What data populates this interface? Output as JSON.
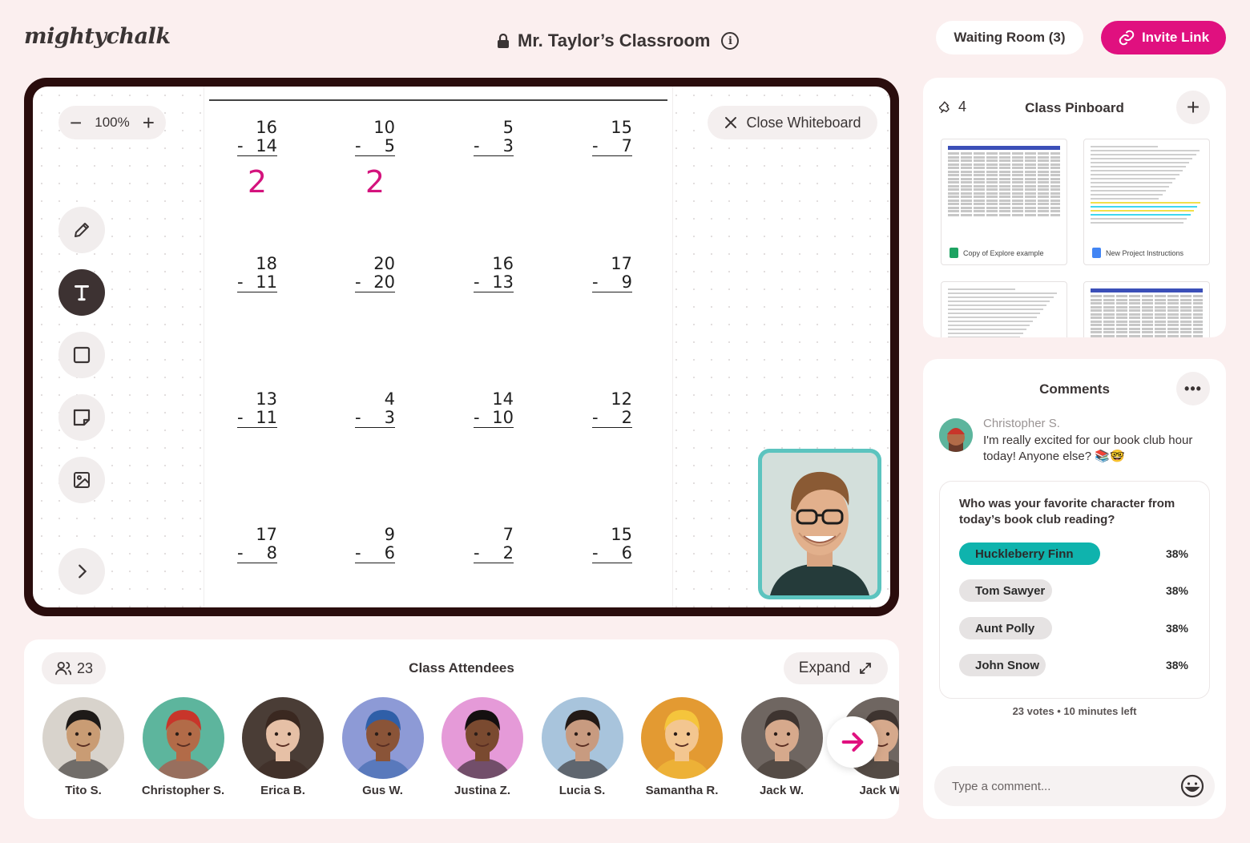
{
  "header": {
    "logo": "mightychalk",
    "room_title": "Mr. Taylor’s Classroom",
    "waiting_room": "Waiting Room (3)",
    "invite_link": "Invite Link"
  },
  "whiteboard": {
    "zoom": "100%",
    "close_label": "Close Whiteboard",
    "tools": [
      "pencil",
      "text",
      "rectangle",
      "sticky-note",
      "image"
    ],
    "active_tool": "text",
    "problems": [
      {
        "top": "16",
        "bottom": "14",
        "answer": "2"
      },
      {
        "top": "10",
        "bottom": "5",
        "answer": "2"
      },
      {
        "top": "5",
        "bottom": "3",
        "answer": ""
      },
      {
        "top": "15",
        "bottom": "7",
        "answer": ""
      },
      {
        "top": "18",
        "bottom": "11",
        "answer": ""
      },
      {
        "top": "20",
        "bottom": "20",
        "answer": ""
      },
      {
        "top": "16",
        "bottom": "13",
        "answer": ""
      },
      {
        "top": "17",
        "bottom": "9",
        "answer": ""
      },
      {
        "top": "13",
        "bottom": "11",
        "answer": ""
      },
      {
        "top": "4",
        "bottom": "3",
        "answer": ""
      },
      {
        "top": "14",
        "bottom": "10",
        "answer": ""
      },
      {
        "top": "12",
        "bottom": "2",
        "answer": ""
      },
      {
        "top": "17",
        "bottom": "8",
        "answer": ""
      },
      {
        "top": "9",
        "bottom": "6",
        "answer": ""
      },
      {
        "top": "7",
        "bottom": "2",
        "answer": ""
      },
      {
        "top": "15",
        "bottom": "6",
        "answer": ""
      }
    ],
    "answer_color": "#d4137d"
  },
  "attendees": {
    "count": "23",
    "title": "Class Attendees",
    "expand_label": "Expand",
    "people": [
      {
        "name": "Tito S.",
        "bg": "#d8d3cc",
        "skin": "#c99c74",
        "hair": "#1e1a18"
      },
      {
        "name": "Christopher S.",
        "bg": "#5db59d",
        "skin": "#b26b48",
        "hair": "#c8352a"
      },
      {
        "name": "Erica B.",
        "bg": "#4a3d36",
        "skin": "#e6c0a6",
        "hair": "#3a2820"
      },
      {
        "name": "Gus W.",
        "bg": "#8d9ad6",
        "skin": "#8a5438",
        "hair": "#2f5fa8"
      },
      {
        "name": "Justina Z.",
        "bg": "#e59ad8",
        "skin": "#7a4a30",
        "hair": "#141010"
      },
      {
        "name": "Lucia S.",
        "bg": "#a8c4dc",
        "skin": "#c89b80",
        "hair": "#231a16"
      },
      {
        "name": "Samantha R.",
        "bg": "#e39a32",
        "skin": "#f3c690",
        "hair": "#f5c53c"
      },
      {
        "name": "Jack W.",
        "bg": "#6f6661",
        "skin": "#d6a98c",
        "hair": "#3e3430"
      },
      {
        "name": "Jack W.",
        "bg": "#6f6661",
        "skin": "#d6a98c",
        "hair": "#3e3430"
      }
    ]
  },
  "pinboard": {
    "pin_count": "4",
    "title": "Class Pinboard",
    "docs": [
      {
        "caption": "Copy of Explore example",
        "kind": "sheet",
        "icon_color": "#1ea362"
      },
      {
        "caption": "New Project Instructions",
        "kind": "doc",
        "icon_color": "#4285f4"
      },
      {
        "caption": "",
        "kind": "doc",
        "icon_color": "#4285f4"
      },
      {
        "caption": "",
        "kind": "sheet",
        "icon_color": "#1ea362"
      }
    ]
  },
  "comments": {
    "title": "Comments",
    "items": [
      {
        "author": "Christopher S.",
        "text": "I'm really excited for our book club hour today! Anyone else? 📚🤓"
      }
    ],
    "poll": {
      "question": "Who was your favorite character from today’s book club reading?",
      "options": [
        {
          "label": "Huckleberry Finn",
          "percent": "38%",
          "fraction": 0.38,
          "selected": true
        },
        {
          "label": "Tom Sawyer",
          "percent": "38%",
          "fraction": 0.38,
          "selected": false
        },
        {
          "label": "Aunt Polly",
          "percent": "38%",
          "fraction": 0.38,
          "selected": false
        },
        {
          "label": "John Snow",
          "percent": "38%",
          "fraction": 0.38,
          "selected": false
        }
      ],
      "votes": "23 votes",
      "time_left": "10 minutes left"
    },
    "input_placeholder": "Type a comment..."
  },
  "colors": {
    "accent": "#e0107f",
    "teal": "#0fb3ad",
    "background": "#fbefef",
    "board_frame": "#2a0d0d"
  }
}
